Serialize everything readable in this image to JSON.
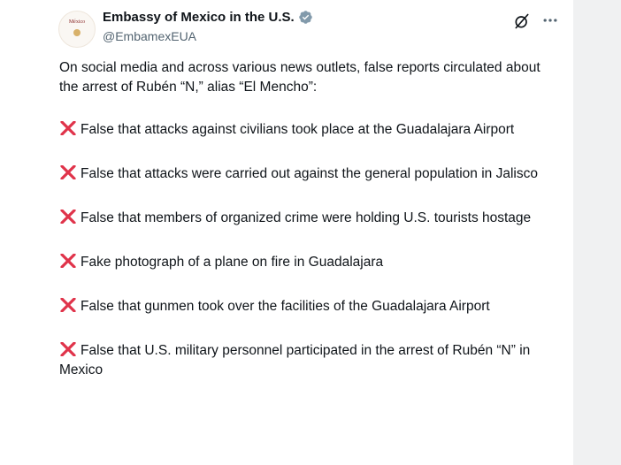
{
  "account": {
    "display_name": "Embassy of Mexico in the U.S.",
    "handle": "@EmbamexEUA",
    "avatar_text": "México"
  },
  "icons": {
    "verified": "verified-badge-icon",
    "grok": "grok-icon",
    "more": "more-options-icon",
    "cross": "cross-mark-icon"
  },
  "colors": {
    "verified_badge": "#829aab",
    "cross_mark": "#e0334a",
    "handle_text": "#536471",
    "right_gutter": "#f0f1f2"
  },
  "post": {
    "intro": "On social media and across various news outlets, false reports circulated about the arrest of Rubén “N,” alias “El Mencho”:",
    "items": [
      "False that attacks against civilians took place at the Guadalajara Airport",
      "False that attacks were carried out against the general population in Jalisco",
      "False that members of organized crime were holding U.S. tourists hostage",
      "Fake photograph of a plane on fire in Guadalajara",
      "False that gunmen took over the facilities of the Guadalajara Airport",
      "False that U.S. military personnel participated in the arrest of Rubén “N” in Mexico"
    ]
  }
}
